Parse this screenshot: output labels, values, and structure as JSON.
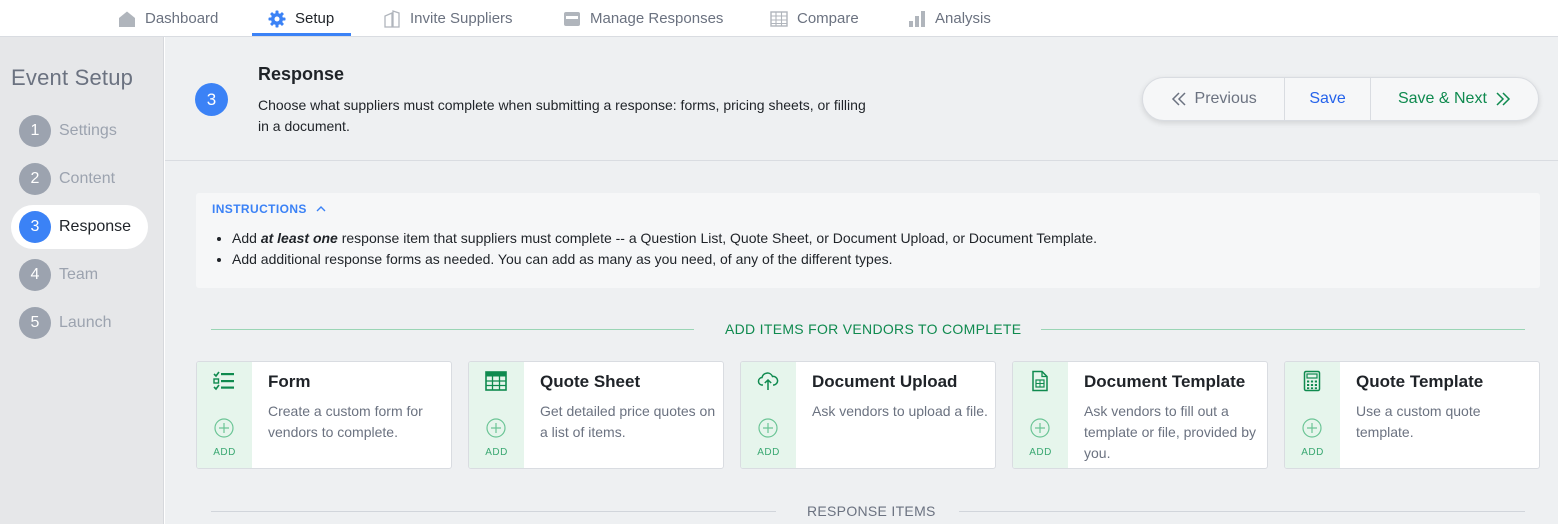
{
  "nav": {
    "items": [
      {
        "label": "Dashboard",
        "icon": "home-icon"
      },
      {
        "label": "Setup",
        "icon": "gear-icon",
        "active": true
      },
      {
        "label": "Invite Suppliers",
        "icon": "building-icon"
      },
      {
        "label": "Manage Responses",
        "icon": "inbox-icon"
      },
      {
        "label": "Compare",
        "icon": "table-icon"
      },
      {
        "label": "Analysis",
        "icon": "bar-chart-icon"
      }
    ]
  },
  "sidebar": {
    "title": "Event Setup",
    "steps": [
      {
        "num": "1",
        "label": "Settings"
      },
      {
        "num": "2",
        "label": "Content"
      },
      {
        "num": "3",
        "label": "Response",
        "active": true
      },
      {
        "num": "4",
        "label": "Team"
      },
      {
        "num": "5",
        "label": "Launch"
      }
    ]
  },
  "header": {
    "step_num": "3",
    "title": "Response",
    "description": "Choose what suppliers must complete when submitting a response: forms, pricing sheets, or filling in a document."
  },
  "actions": {
    "previous": "Previous",
    "save": "Save",
    "save_next": "Save & Next"
  },
  "instructions": {
    "heading": "INSTRUCTIONS",
    "line1_pre": "Add ",
    "line1_emph": "at least one",
    "line1_post": " response item that suppliers must complete -- a Question List, Quote Sheet, or Document Upload, or Document Template.",
    "line2": "Add additional response forms as needed. You can add as many as you need, of any of the different types."
  },
  "sections": {
    "add_items": "ADD ITEMS FOR VENDORS TO COMPLETE",
    "response_items": "RESPONSE ITEMS"
  },
  "cards": [
    {
      "title": "Form",
      "description": "Create a custom form for vendors to complete.",
      "add": "ADD",
      "icon": "checklist-icon"
    },
    {
      "title": "Quote Sheet",
      "description": "Get detailed price quotes on a list of items.",
      "add": "ADD",
      "icon": "spreadsheet-icon"
    },
    {
      "title": "Document Upload",
      "description": "Ask vendors to upload a file.",
      "add": "ADD",
      "icon": "cloud-upload-icon"
    },
    {
      "title": "Document Template",
      "description": "Ask vendors to fill out a template or file, provided by you.",
      "add": "ADD",
      "icon": "document-icon"
    },
    {
      "title": "Quote Template",
      "description": "Use a custom quote template.",
      "add": "ADD",
      "icon": "calculator-icon"
    }
  ],
  "colors": {
    "accent_blue": "#3b82f6",
    "accent_green": "#0f8a4f",
    "card_left_bg": "#e6f5ec"
  }
}
